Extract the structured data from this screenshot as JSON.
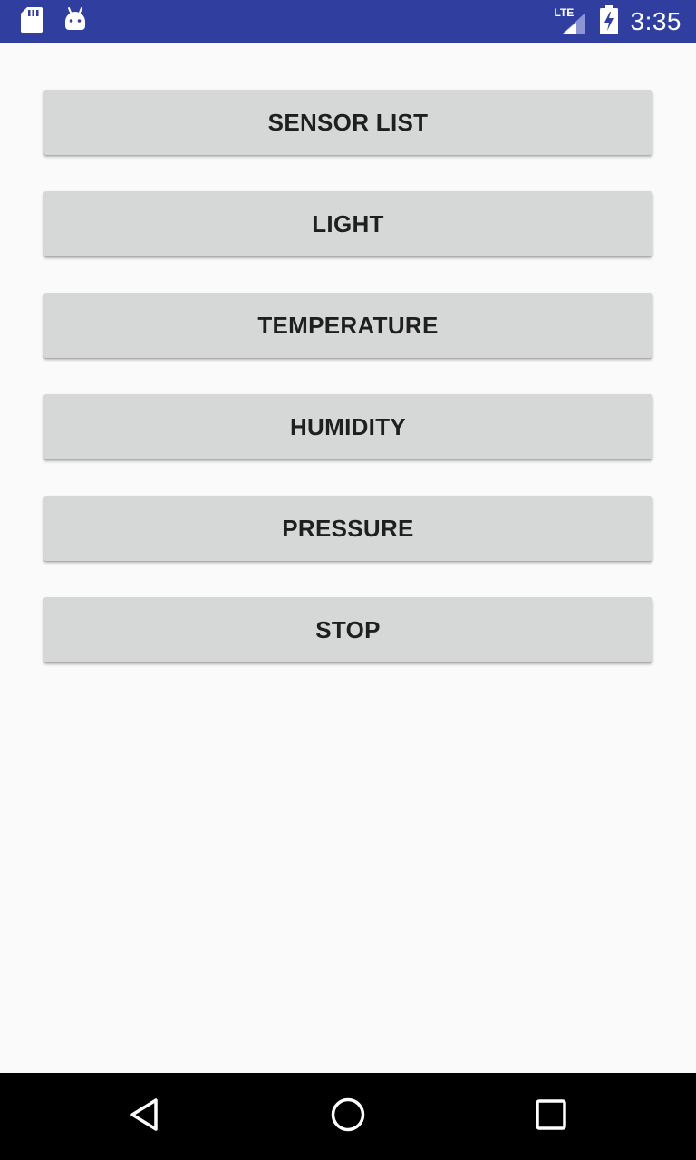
{
  "status_bar": {
    "time": "3:35",
    "network_type": "LTE",
    "icons": [
      "sd-card-icon",
      "android-debug-icon",
      "signal-icon",
      "battery-charging-icon"
    ],
    "background_color": "#303f9f"
  },
  "buttons": [
    {
      "label": "SENSOR LIST"
    },
    {
      "label": "LIGHT"
    },
    {
      "label": "TEMPERATURE"
    },
    {
      "label": "HUMIDITY"
    },
    {
      "label": "PRESSURE"
    },
    {
      "label": "STOP"
    }
  ],
  "nav_bar": {
    "icons": [
      "back-icon",
      "home-icon",
      "recents-icon"
    ]
  },
  "colors": {
    "button_background": "#d6d7d7",
    "button_text": "#1f1f1f",
    "page_background": "#fafafa"
  }
}
